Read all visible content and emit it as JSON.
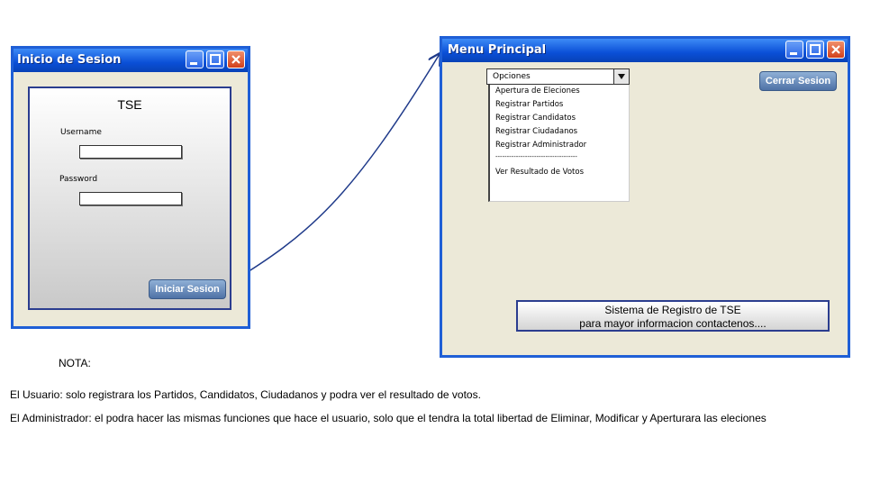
{
  "login_window": {
    "title": "Inicio de Sesion",
    "app_label": "TSE",
    "username_label": "Username",
    "username_value": "",
    "password_label": "Password",
    "password_value": "",
    "login_button": "Iniciar Sesion"
  },
  "menu_window": {
    "title": "Menu Principal",
    "dropdown": {
      "selected": "Opciones",
      "items": [
        "Apertura de Eleciones",
        "Registrar Partidos",
        "Registrar Candidatos",
        "Registrar Ciudadanos",
        "Registrar Administrador",
        "------------------------------------",
        "Ver Resultado de Votos"
      ]
    },
    "logout_button": "Cerrar Sesion",
    "status_line1": "Sistema de Registro de TSE",
    "status_line2": "para mayor informacion contactenos...."
  },
  "notes": {
    "heading": "NOTA:",
    "usuario": "El Usuario: solo registrara los Partidos, Candidatos, Ciudadanos y podra ver el resultado de votos.",
    "administrador": "El Administrador: el podra hacer las mismas funciones que hace el usuario, solo que el tendra la total libertad de Eliminar, Modificar y Aperturara las eleciones"
  },
  "colors": {
    "titlebar": "#0a4fd7",
    "window_bg": "#ece9d8",
    "button": "#4f72a6",
    "connector": "#1f3a8a"
  }
}
